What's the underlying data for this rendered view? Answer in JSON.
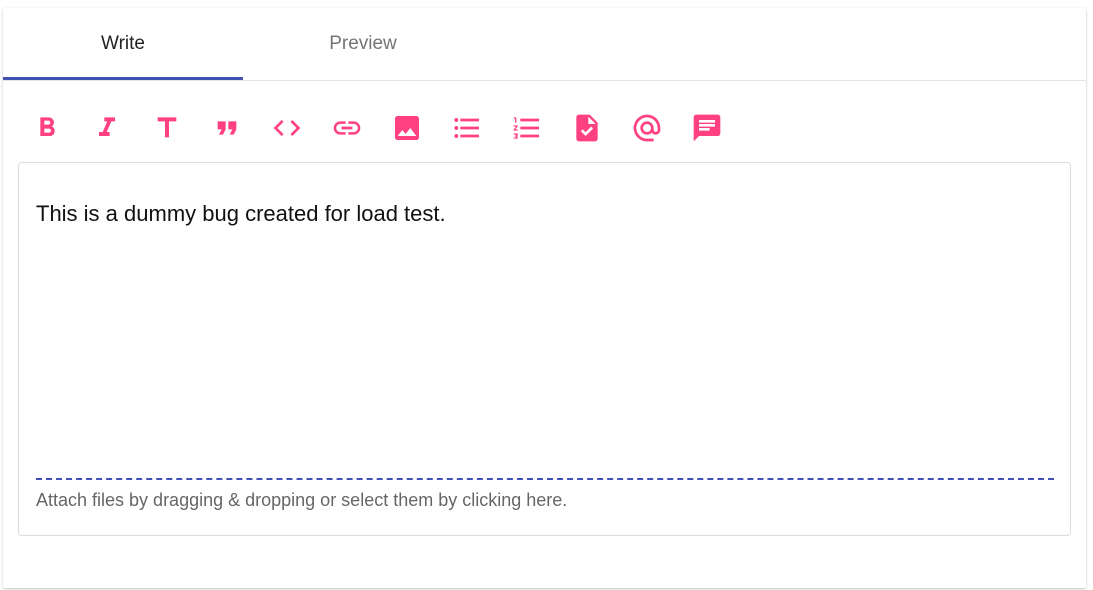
{
  "tabs": {
    "write_label": "Write",
    "preview_label": "Preview",
    "active": "Write"
  },
  "toolbar": {
    "icons": [
      "bold-icon",
      "italic-icon",
      "header-icon",
      "quote-icon",
      "code-icon",
      "link-icon",
      "image-icon",
      "unordered-list-icon",
      "ordered-list-icon",
      "task-list-icon",
      "mention-icon",
      "saved-reply-icon"
    ]
  },
  "editor": {
    "value": "This is a dummy bug created for load test.",
    "attach_hint": "Attach files by dragging & dropping or select them by clicking here."
  },
  "colors": {
    "accent": "#3f51b5",
    "icon": "#ff4081"
  }
}
